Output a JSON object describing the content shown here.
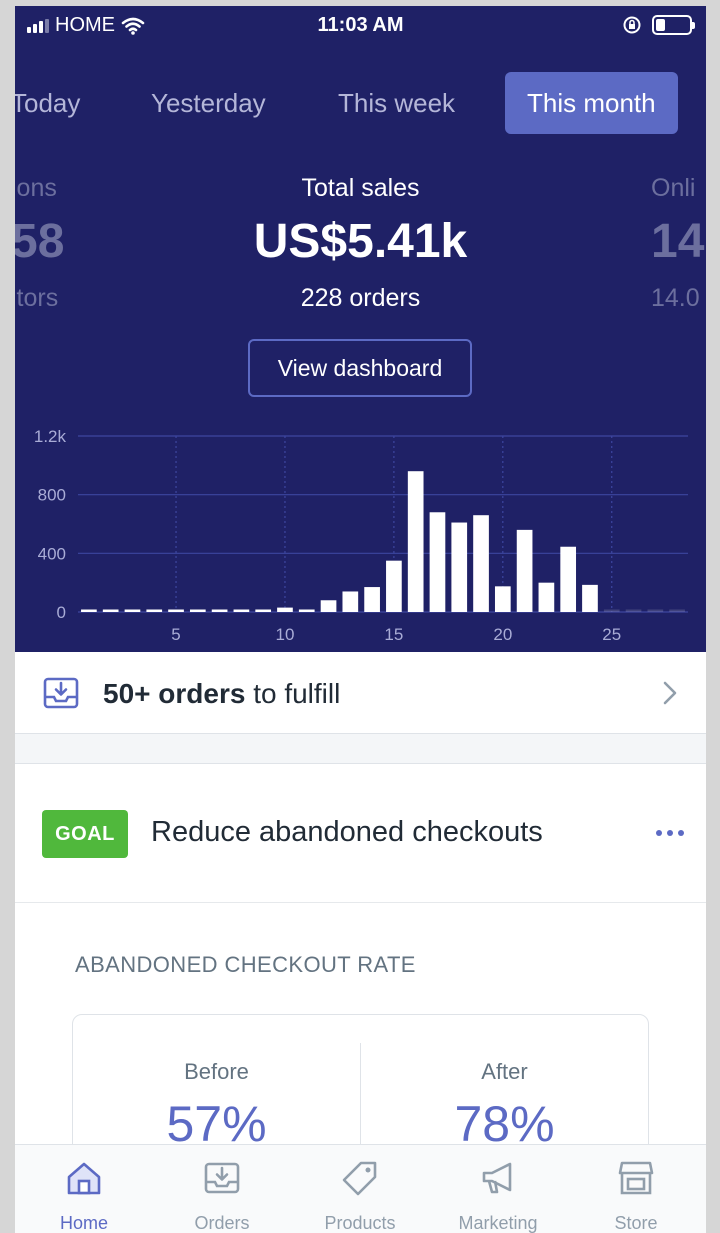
{
  "status_bar": {
    "carrier": "HOME",
    "time": "11:03 AM"
  },
  "range_tabs": [
    {
      "label": "Today",
      "active": false
    },
    {
      "label": "Yesterday",
      "active": false
    },
    {
      "label": "This week",
      "active": false
    },
    {
      "label": "This month",
      "active": true
    }
  ],
  "stats": {
    "left_partial": {
      "label": "ions",
      "value": "58",
      "sub": "itors"
    },
    "center": {
      "label": "Total sales",
      "value": "US$5.41k",
      "sub": "228 orders"
    },
    "right_partial": {
      "label": "Onli",
      "value": "14",
      "sub": "14.0"
    }
  },
  "dashboard_button": "View dashboard",
  "chart_data": {
    "type": "bar",
    "x": [
      1,
      2,
      3,
      4,
      5,
      6,
      7,
      8,
      9,
      10,
      11,
      12,
      13,
      14,
      15,
      16,
      17,
      18,
      19,
      20,
      21,
      22,
      23,
      24,
      25,
      26,
      27,
      28
    ],
    "values": [
      5,
      5,
      5,
      5,
      5,
      5,
      5,
      5,
      5,
      30,
      15,
      80,
      140,
      170,
      350,
      960,
      680,
      610,
      660,
      175,
      560,
      200,
      445,
      185,
      5,
      5,
      5,
      5
    ],
    "x_ticks": [
      "5",
      "10",
      "15",
      "20",
      "25"
    ],
    "y_ticks": [
      "0",
      "400",
      "800",
      "1.2k"
    ],
    "ylim": [
      0,
      1200
    ],
    "grid": true,
    "colors": {
      "bars": "#ffffff",
      "grid": "#3d46a0",
      "tick_label": "#a9acd6",
      "background": "#1f2166"
    }
  },
  "fulfill": {
    "count_bold": "50+ orders",
    "rest": "to fulfill"
  },
  "goal": {
    "badge": "GOAL",
    "title": "Reduce abandoned checkouts",
    "rate_heading": "ABANDONED CHECKOUT RATE",
    "before_label": "Before",
    "before_value": "57%",
    "after_label": "After",
    "after_value": "78%"
  },
  "bottom_nav": [
    {
      "label": "Home",
      "icon": "home-icon",
      "active": true
    },
    {
      "label": "Orders",
      "icon": "orders-icon",
      "active": false
    },
    {
      "label": "Products",
      "icon": "tag-icon",
      "active": false
    },
    {
      "label": "Marketing",
      "icon": "megaphone-icon",
      "active": false
    },
    {
      "label": "Store",
      "icon": "store-icon",
      "active": false
    }
  ],
  "colors": {
    "header_bg": "#1f2166",
    "accent": "#5c6ac4",
    "goal_green": "#50b83c"
  }
}
